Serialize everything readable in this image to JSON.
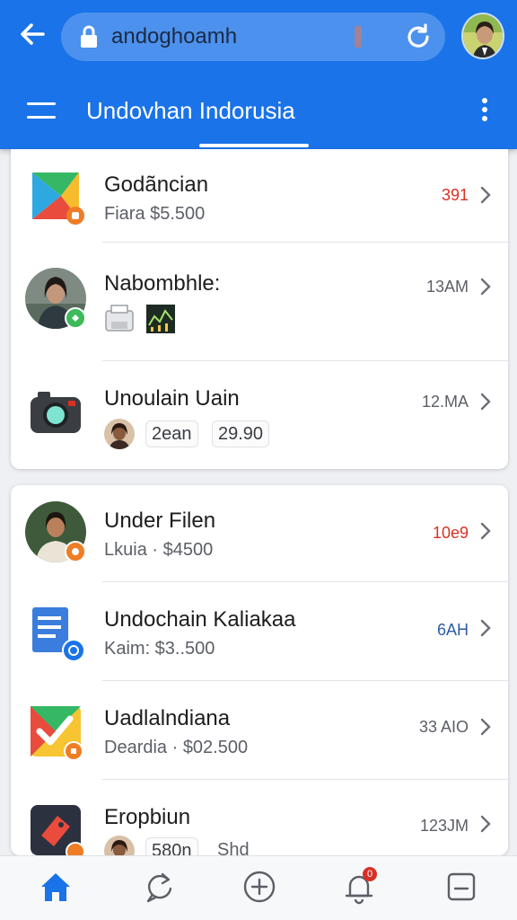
{
  "browser": {
    "url_text": "andoghoamh"
  },
  "header": {
    "title": "Undovhan Indorusia"
  },
  "list": {
    "items": [
      {
        "title": "Godãncian",
        "subtitle": "Fiara  $5.500",
        "time": "391",
        "time_color": "red"
      },
      {
        "title": "Nabombhle:",
        "subtitle": "",
        "time": "13AM"
      },
      {
        "title": "Unoulain Uain",
        "chip1": "2ean",
        "chip2": "29.90",
        "time": "12.MA"
      },
      {
        "title": "Under Filen",
        "subtitle": "Lkuia · $4500",
        "time": "10e9",
        "time_color": "red"
      },
      {
        "title": "Undochain Kaliakaa",
        "subtitle": "Kaim: $3..500",
        "time": "6AH",
        "time_color": "blue"
      },
      {
        "title": "Uadlalndiana",
        "subtitle": "Deardia · $02.500",
        "time": "33 AIO"
      },
      {
        "title": "Eropbiun",
        "chip1": "580n",
        "chip2": "Shd",
        "time": "123JM"
      }
    ]
  },
  "colors": {
    "brand": "#1a73e8",
    "accent_red": "#d93025",
    "nav_active": "#1a73e8"
  },
  "bottom_nav": {
    "items": [
      "home-icon",
      "refresh-chat-icon",
      "add-circle-icon",
      "notification-bell-icon",
      "document-icon"
    ],
    "notification_count": "0"
  }
}
